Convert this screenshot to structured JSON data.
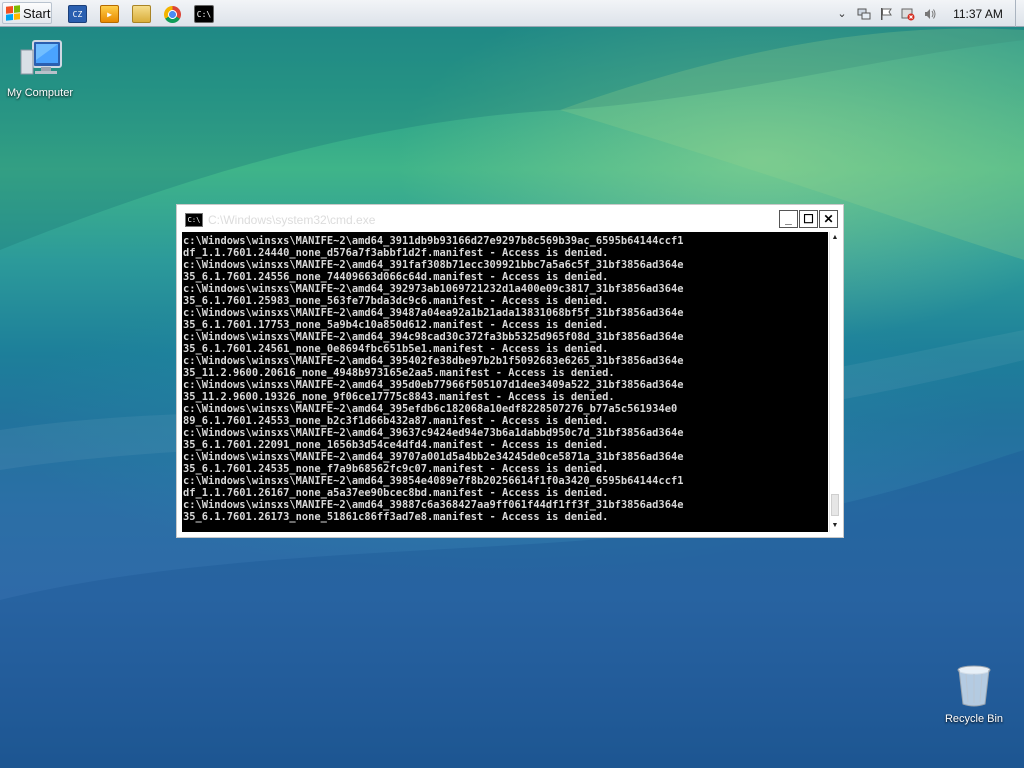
{
  "taskbar": {
    "start_label": "Start",
    "quick_launch": [
      {
        "name": "cpu-z-icon",
        "glyph": "CZ"
      },
      {
        "name": "media-player-icon",
        "glyph": "▶"
      },
      {
        "name": "folder-icon",
        "glyph": ""
      },
      {
        "name": "chrome-icon",
        "glyph": ""
      },
      {
        "name": "command-prompt-icon",
        "glyph": "C:\\"
      }
    ],
    "tray": {
      "icons": [
        "chevron-down-icon",
        "network-icon",
        "flag-icon",
        "security-icon",
        "volume-icon"
      ],
      "clock": "11:37 AM"
    }
  },
  "desktop": {
    "icons": [
      {
        "label": "My Computer",
        "icon": "computer-icon"
      },
      {
        "label": "Recycle Bin",
        "icon": "recycle-bin-icon"
      }
    ]
  },
  "console": {
    "title": "C:\\Windows\\system32\\cmd.exe",
    "lines": [
      "c:\\Windows\\winsxs\\MANIFE~2\\amd64_3911db9b93166d27e9297b8c569b39ac_6595b64144ccf1",
      "df_1.1.7601.24440_none_d576a7f3abbf1d2f.manifest - Access is denied.",
      "c:\\Windows\\winsxs\\MANIFE~2\\amd64_391faf308b71ecc309921bbc7a5a6c5f_31bf3856ad364e",
      "35_6.1.7601.24556_none_74409663d066c64d.manifest - Access is denied.",
      "c:\\Windows\\winsxs\\MANIFE~2\\amd64_392973ab1069721232d1a400e09c3817_31bf3856ad364e",
      "35_6.1.7601.25983_none_563fe77bda3dc9c6.manifest - Access is denied.",
      "c:\\Windows\\winsxs\\MANIFE~2\\amd64_39487a04ea92a1b21ada13831068bf5f_31bf3856ad364e",
      "35_6.1.7601.17753_none_5a9b4c10a850d612.manifest - Access is denied.",
      "c:\\Windows\\winsxs\\MANIFE~2\\amd64_394c98cad30c372fa3bb5325d965f08d_31bf3856ad364e",
      "35_6.1.7601.24561_none_0e8694fbc651b5e1.manifest - Access is denied.",
      "c:\\Windows\\winsxs\\MANIFE~2\\amd64_395402fe38dbe97b2b1f5092683e6265_31bf3856ad364e",
      "35_11.2.9600.20616_none_4948b973165e2aa5.manifest - Access is denied.",
      "c:\\Windows\\winsxs\\MANIFE~2\\amd64_395d0eb77966f505107d1dee3409a522_31bf3856ad364e",
      "35_11.2.9600.19326_none_9f06ce17775c8843.manifest - Access is denied.",
      "c:\\Windows\\winsxs\\MANIFE~2\\amd64_395efdb6c182068a10edf8228507276_b77a5c561934e0",
      "89_6.1.7601.24553_none_b2c3f1d66b432a87.manifest - Access is denied.",
      "c:\\Windows\\winsxs\\MANIFE~2\\amd64_39637c9424ed94e73b6a1dabbd950c7d_31bf3856ad364e",
      "35_6.1.7601.22091_none_1656b3d54ce4dfd4.manifest - Access is denied.",
      "c:\\Windows\\winsxs\\MANIFE~2\\amd64_39707a001d5a4bb2e34245de0ce5871a_31bf3856ad364e",
      "35_6.1.7601.24535_none_f7a9b68562fc9c07.manifest - Access is denied.",
      "c:\\Windows\\winsxs\\MANIFE~2\\amd64_39854e4089e7f8b20256614f1f0a3420_6595b64144ccf1",
      "df_1.1.7601.26167_none_a5a37ee90bcec8bd.manifest - Access is denied.",
      "c:\\Windows\\winsxs\\MANIFE~2\\amd64_39887c6a368427aa9ff061f44df1ff3f_31bf3856ad364e",
      "35_6.1.7601.26173_none_51861c86ff3ad7e8.manifest - Access is denied."
    ],
    "caption_buttons": {
      "minimize": "_",
      "maximize": "☐",
      "close": "✕"
    }
  }
}
